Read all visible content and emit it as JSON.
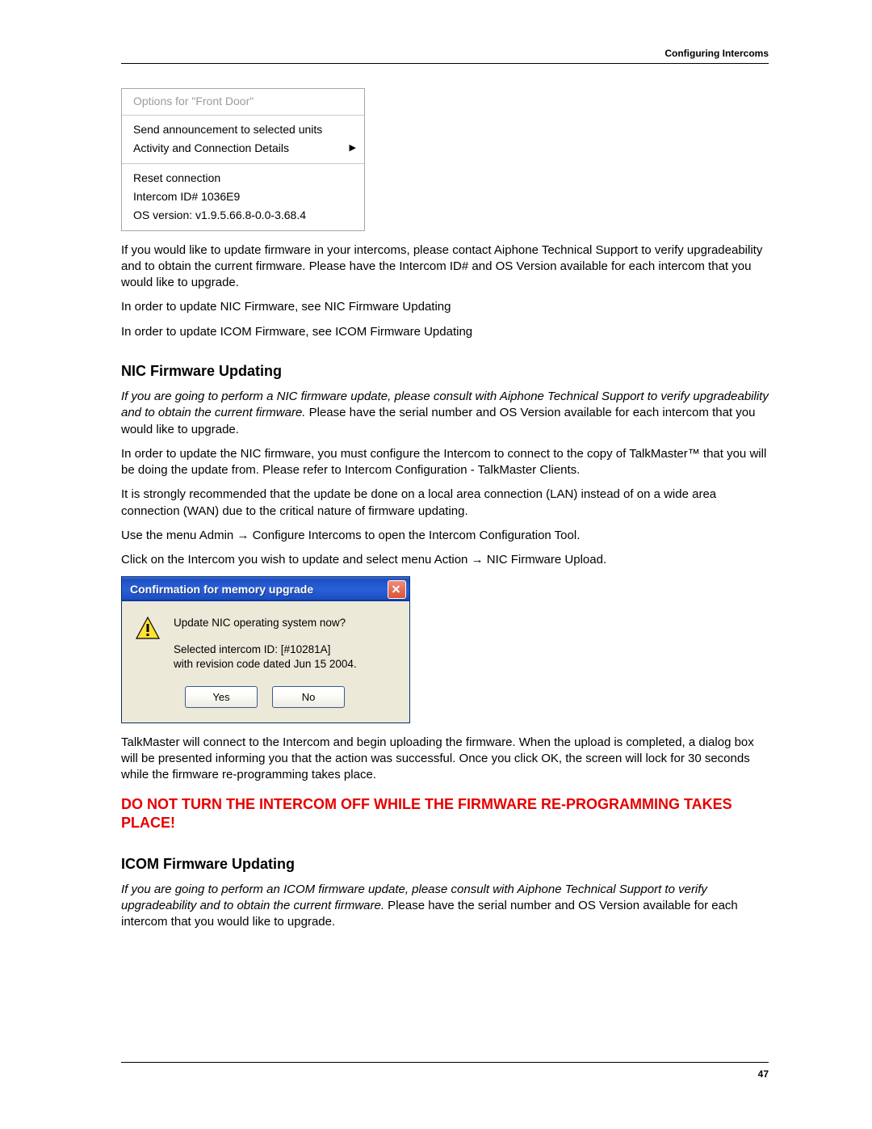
{
  "header": {
    "section": "Configuring Intercoms"
  },
  "options_menu": {
    "title": "Options for  \"Front Door\"",
    "send": "Send announcement to selected units",
    "activity": "Activity and Connection Details",
    "arrow": "▶",
    "reset": "Reset connection",
    "id": "Intercom ID# 1036E9",
    "os": "OS version: v1.9.5.66.8-0.0-3.68.4"
  },
  "p1": "If you would like to update firmware in your intercoms, please contact Aiphone Technical Support to verify upgradeability and to obtain the current firmware.  Please have the Intercom ID# and OS Version available for each intercom that you would like to upgrade.",
  "p2": "In order to update NIC Firmware, see NIC Firmware Updating",
  "p3": "In order to update ICOM Firmware, see ICOM Firmware Updating",
  "nic": {
    "title": "NIC Firmware Updating",
    "p1a": "If you are going to perform a NIC firmware update, please consult with Aiphone Technical Support to verify upgradeability and to obtain the current firmware.",
    "p1b": "  Please have the serial number and OS Version available for each intercom that you would like to upgrade.",
    "p2": "In order to update the NIC firmware, you must configure the Intercom to connect to the copy of TalkMaster™ that you will be doing the update from.  Please refer to Intercom Configuration - TalkMaster Clients.",
    "p3": "It is strongly recommended that the update be done on a local area connection (LAN) instead of on a wide area connection (WAN) due to the critical nature of firmware updating.",
    "p4": "Use the menu Admin → Configure Intercoms to open the Intercom Configuration Tool.",
    "p5": "Click on the Intercom you wish to update and select menu Action → NIC Firmware Upload."
  },
  "dialog": {
    "title": "Confirmation for memory upgrade",
    "q": "Update NIC operating system now?",
    "line1": "Selected intercom ID:  [#10281A]",
    "line2": "with revision code dated Jun 15 2004.",
    "yes": "Yes",
    "no": "No"
  },
  "after_dialog": "TalkMaster will connect to the Intercom and begin uploading the firmware.  When the upload is completed, a dialog box will be presented informing you that the action was successful. Once you click OK, the screen will lock for 30 seconds while the firmware re-programming takes place.",
  "warning": "DO NOT TURN THE INTERCOM OFF WHILE THE FIRMWARE RE-PROGRAMMING TAKES PLACE!",
  "icom": {
    "title": "ICOM Firmware Updating",
    "p1a": "If you are going to perform an ICOM firmware update, please consult with Aiphone Technical Support to verify upgradeability and to obtain the current firmware.",
    "p1b": "  Please have the serial number and OS Version available for each intercom that you would like to upgrade."
  },
  "footer": {
    "page": "47"
  }
}
